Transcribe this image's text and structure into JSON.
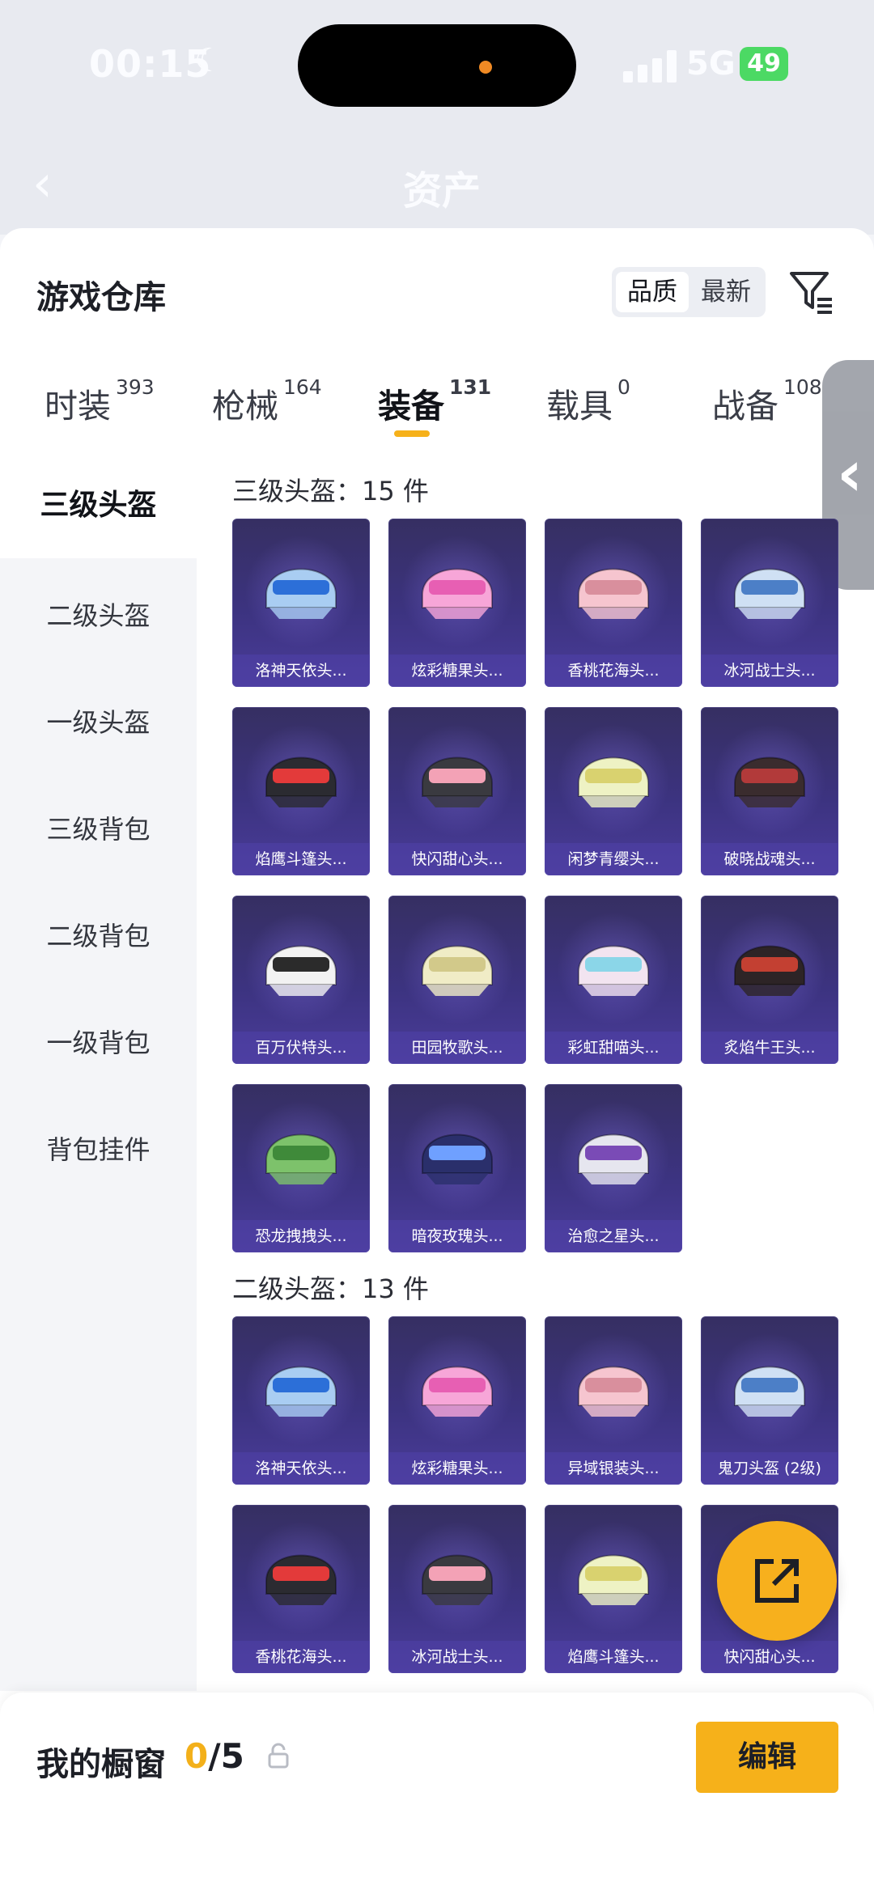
{
  "status_bar": {
    "time": "00:15",
    "network": "5G",
    "battery": "49"
  },
  "header": {
    "title": "资产"
  },
  "warehouse": {
    "title": "游戏仓库",
    "sort_options": [
      "品质",
      "最新"
    ],
    "active_sort": "品质"
  },
  "tabs": [
    {
      "label": "时装",
      "count": "393"
    },
    {
      "label": "枪械",
      "count": "164"
    },
    {
      "label": "装备",
      "count": "131"
    },
    {
      "label": "载具",
      "count": "0"
    },
    {
      "label": "战备",
      "count": "108"
    }
  ],
  "active_tab": "装备",
  "sidebar": {
    "items": [
      "三级头盔",
      "二级头盔",
      "一级头盔",
      "三级背包",
      "二级背包",
      "一级背包",
      "背包挂件"
    ],
    "active": "三级头盔"
  },
  "sections": [
    {
      "label": "三级头盔：15 件",
      "items": [
        "洛神天依头...",
        "炫彩糖果头...",
        "香桃花海头...",
        "冰河战士头...",
        "焰鹰斗篷头...",
        "快闪甜心头...",
        "闲梦青缨头...",
        "破晓战魂头...",
        "百万伏特头...",
        "田园牧歌头...",
        "彩虹甜喵头...",
        "炙焰牛王头...",
        "恐龙拽拽头...",
        "暗夜玫瑰头...",
        "治愈之星头..."
      ]
    },
    {
      "label": "二级头盔：13 件",
      "items": [
        "洛神天依头...",
        "炫彩糖果头...",
        "异域银装头...",
        "鬼刀头盔 (2级)",
        "香桃花海头...",
        "冰河战士头...",
        "焰鹰斗篷头...",
        "快闪甜心头..."
      ]
    }
  ],
  "bottom_bar": {
    "label": "我的橱窗",
    "used": "0",
    "total": "/5",
    "edit_label": "编辑"
  },
  "colors": {
    "accent": "#f6b11a",
    "item_bg": "#3c3380"
  },
  "icons": [
    "back-arrow-icon",
    "moon-icon",
    "filter-icon",
    "chevron-left-icon",
    "share-icon",
    "lock-icon"
  ]
}
